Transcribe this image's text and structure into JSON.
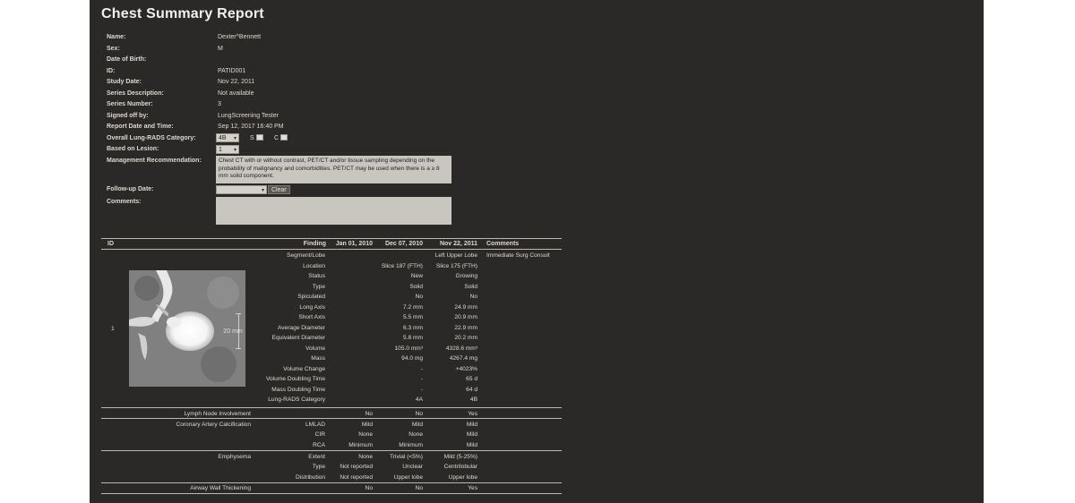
{
  "title": "Chest Summary Report",
  "patient": {
    "labels": [
      "Name:",
      "Sex:",
      "Date of Birth:",
      "ID:",
      "Study Date:",
      "Series Description:",
      "Series Number:",
      "Signed off by:",
      "Report Date and Time:",
      "Overall Lung-RADS Category:",
      "Based on Lesion:",
      "Management Recommendation:",
      "Follow-up Date:",
      "Comments:"
    ],
    "values": [
      "Dexter^Bennett",
      "M",
      "",
      "PATID001",
      "Nov 22, 2011",
      "Not available",
      "3",
      "LungScreening Tester",
      "Sep 12, 2017 16:40 PM"
    ]
  },
  "controls": {
    "category_value": "4B",
    "s_label": "S",
    "c_label": "C",
    "lesion_value": "1",
    "recommendation": "Chest CT with or without contrast, PET/CT and/or tissue sampling depending on the probability of malignancy and comorbidities. PET/CT may be used when there is a ≥ 8 mm solid component.",
    "followup_value": "",
    "clear_label": "Clear",
    "comments_value": ""
  },
  "table": {
    "headers": {
      "id": "ID",
      "finding": "Finding",
      "dates": [
        "Jan 01, 2010",
        "Dec 07, 2010",
        "Nov 22, 2011"
      ],
      "comments": "Comments"
    },
    "nodule_id": "1",
    "scale_label": "20 mm",
    "nodule_rows": [
      {
        "label": "Segment/Lobe",
        "d1": "",
        "d2": "",
        "d3": "Left Upper Lobe",
        "comment": "Immediate Surg Consult"
      },
      {
        "label": "Location",
        "d1": "",
        "d2": "Slice 187 (FTH)",
        "d3": "Slice 175 (FTH)",
        "comment": ""
      },
      {
        "label": "Status",
        "d1": "",
        "d2": "New",
        "d3": "Growing",
        "comment": ""
      },
      {
        "label": "Type",
        "d1": "",
        "d2": "Solid",
        "d3": "Solid",
        "comment": ""
      },
      {
        "label": "Spiculated",
        "d1": "",
        "d2": "No",
        "d3": "No",
        "comment": ""
      },
      {
        "label": "Long Axis",
        "d1": "",
        "d2": "7.2 mm",
        "d3": "24.9 mm",
        "comment": ""
      },
      {
        "label": "Short Axis",
        "d1": "",
        "d2": "5.5 mm",
        "d3": "20.9 mm",
        "comment": ""
      },
      {
        "label": "Average Diameter",
        "d1": "",
        "d2": "6.3 mm",
        "d3": "22.9 mm",
        "comment": ""
      },
      {
        "label": "Equivalent Diameter",
        "d1": "",
        "d2": "5.8 mm",
        "d3": "20.2 mm",
        "comment": ""
      },
      {
        "label": "Volume",
        "d1": "",
        "d2": "105.0 mm³",
        "d3": "4328.6 mm³",
        "comment": ""
      },
      {
        "label": "Mass",
        "d1": "",
        "d2": "94.0 mg",
        "d3": "4267.4 mg",
        "comment": ""
      },
      {
        "label": "Volume Change",
        "d1": "",
        "d2": "-",
        "d3": "+4023%",
        "comment": ""
      },
      {
        "label": "Volume Doubling Time",
        "d1": "",
        "d2": "-",
        "d3": "65 d",
        "comment": ""
      },
      {
        "label": "Mass Doubling Time",
        "d1": "",
        "d2": "-",
        "d3": "64 d",
        "comment": ""
      },
      {
        "label": "Lung-RADS Category",
        "d1": "",
        "d2": "4A",
        "d3": "4B",
        "comment": ""
      }
    ],
    "lymph": {
      "label": "Lymph Node Involvement",
      "d1": "No",
      "d2": "No",
      "d3": "Yes"
    },
    "coronary": {
      "label": "Coronary Artery Calcification",
      "rows": [
        {
          "sub": "LMLAD",
          "d1": "Mild",
          "d2": "Mild",
          "d3": "Mild"
        },
        {
          "sub": "CIR",
          "d1": "None",
          "d2": "None",
          "d3": "Mild"
        },
        {
          "sub": "RCA",
          "d1": "Minimum",
          "d2": "Minimum",
          "d3": "Mild"
        }
      ]
    },
    "emphysema": {
      "label": "Emphysema",
      "rows": [
        {
          "sub": "Extent",
          "d1": "None",
          "d2": "Trivial (<5%)",
          "d3": "Mild (5-25%)"
        },
        {
          "sub": "Type",
          "d1": "Not reported",
          "d2": "Unclear",
          "d3": "Centrilobular"
        },
        {
          "sub": "Distribution",
          "d1": "Not reported",
          "d2": "Upper lobe",
          "d3": "Upper lobe"
        }
      ]
    },
    "airway": {
      "label": "Airway Wall Thickening",
      "d1": "No",
      "d2": "No",
      "d3": "Yes"
    }
  },
  "colors": {
    "background": "#2b2927",
    "text": "#e6e3de",
    "field": "#c9c6c0"
  }
}
